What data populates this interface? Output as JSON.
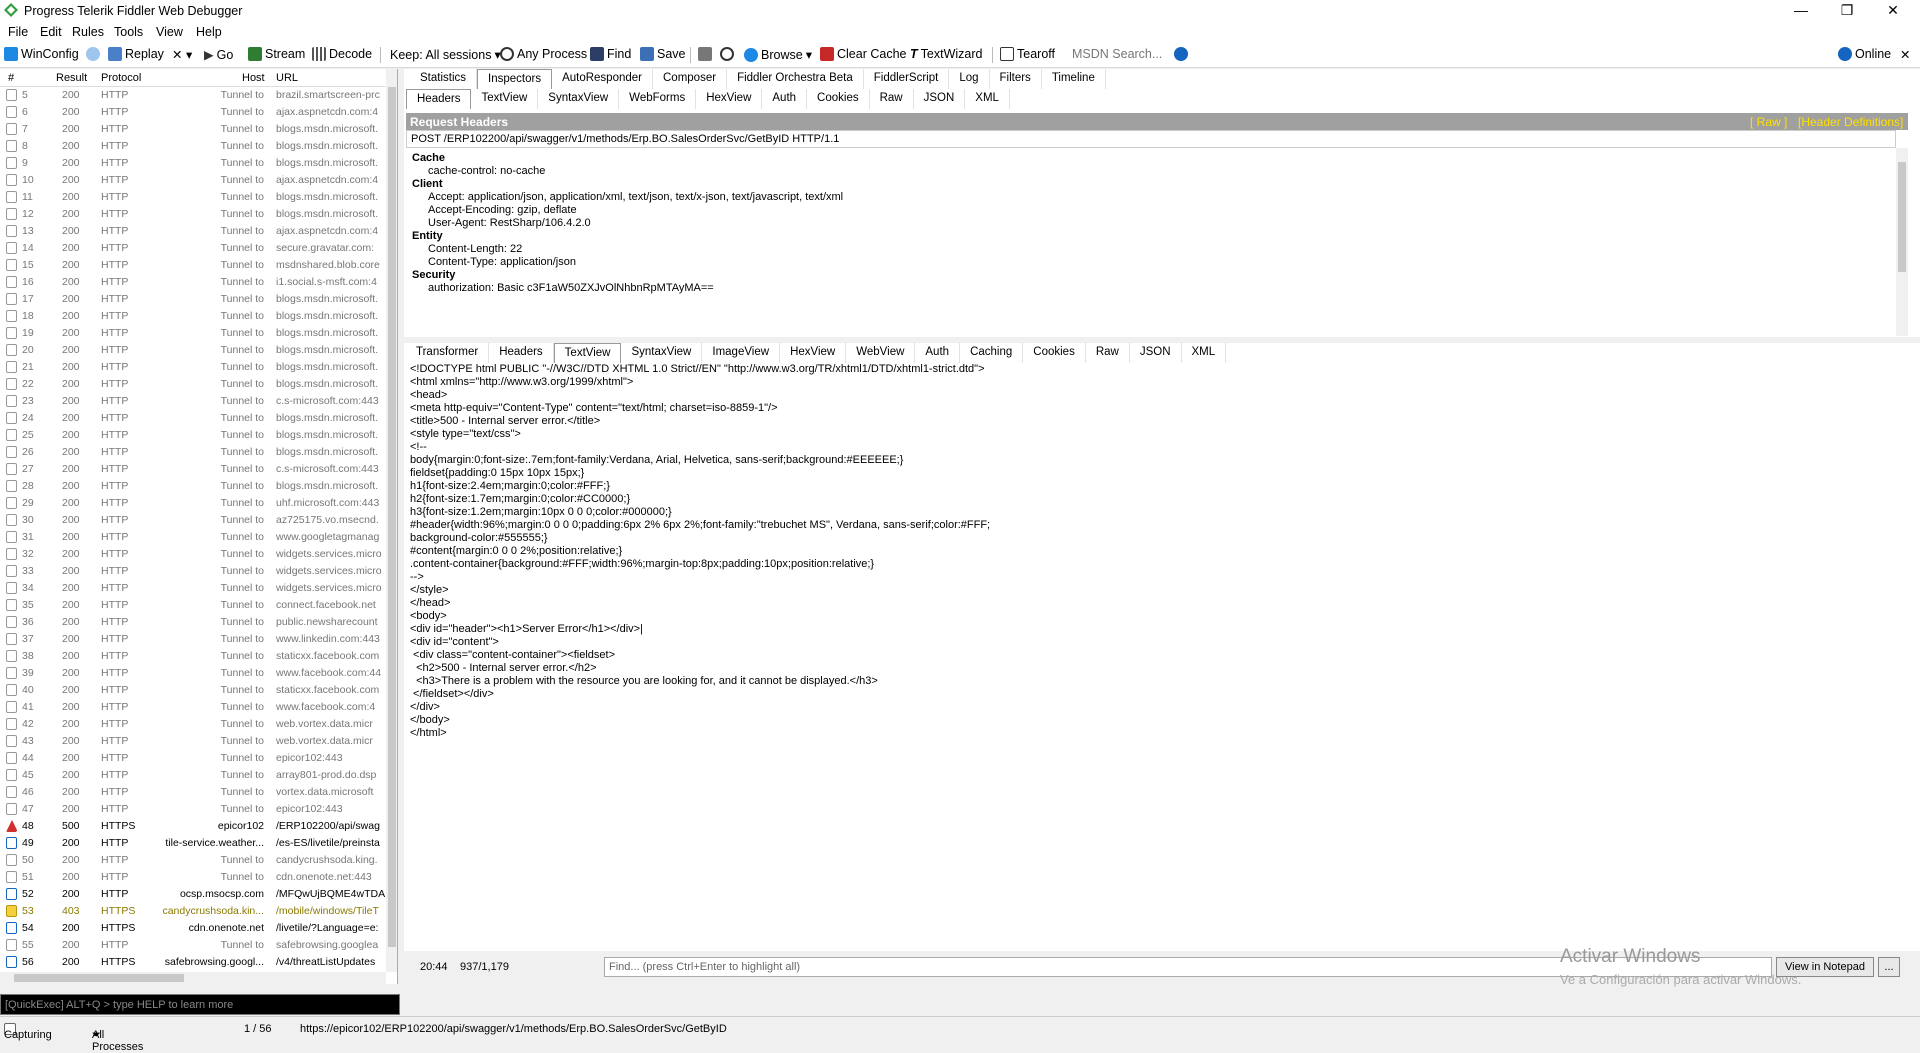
{
  "app": {
    "title": "Progress Telerik Fiddler Web Debugger"
  },
  "menu": [
    "File",
    "Edit",
    "Rules",
    "Tools",
    "View",
    "Help"
  ],
  "toolbar": {
    "winconfig": "WinConfig",
    "replay": "Replay",
    "x": "✕ ▾",
    "go": "Go",
    "stream": "Stream",
    "decode": "Decode",
    "keep": "Keep: All sessions",
    "any_process": "Any Process",
    "find": "Find",
    "save": "Save",
    "browse": "Browse",
    "clear_cache": "Clear Cache",
    "textwizard": "TextWizard",
    "tearoff": "Tearoff",
    "msdn_placeholder": "MSDN Search...",
    "online": "Online"
  },
  "sessions": {
    "headers": [
      "#",
      "Result",
      "Protocol",
      "Host",
      "URL"
    ],
    "rows": [
      [
        "5",
        "200",
        "HTTP",
        "Tunnel to",
        "brazil.smartscreen-prc"
      ],
      [
        "6",
        "200",
        "HTTP",
        "Tunnel to",
        "ajax.aspnetcdn.com:4"
      ],
      [
        "7",
        "200",
        "HTTP",
        "Tunnel to",
        "blogs.msdn.microsoft."
      ],
      [
        "8",
        "200",
        "HTTP",
        "Tunnel to",
        "blogs.msdn.microsoft."
      ],
      [
        "9",
        "200",
        "HTTP",
        "Tunnel to",
        "blogs.msdn.microsoft."
      ],
      [
        "10",
        "200",
        "HTTP",
        "Tunnel to",
        "ajax.aspnetcdn.com:4"
      ],
      [
        "11",
        "200",
        "HTTP",
        "Tunnel to",
        "blogs.msdn.microsoft."
      ],
      [
        "12",
        "200",
        "HTTP",
        "Tunnel to",
        "blogs.msdn.microsoft."
      ],
      [
        "13",
        "200",
        "HTTP",
        "Tunnel to",
        "ajax.aspnetcdn.com:4"
      ],
      [
        "14",
        "200",
        "HTTP",
        "Tunnel to",
        "secure.gravatar.com:"
      ],
      [
        "15",
        "200",
        "HTTP",
        "Tunnel to",
        "msdnshared.blob.core"
      ],
      [
        "16",
        "200",
        "HTTP",
        "Tunnel to",
        "i1.social.s-msft.com:4"
      ],
      [
        "17",
        "200",
        "HTTP",
        "Tunnel to",
        "blogs.msdn.microsoft."
      ],
      [
        "18",
        "200",
        "HTTP",
        "Tunnel to",
        "blogs.msdn.microsoft."
      ],
      [
        "19",
        "200",
        "HTTP",
        "Tunnel to",
        "blogs.msdn.microsoft."
      ],
      [
        "20",
        "200",
        "HTTP",
        "Tunnel to",
        "blogs.msdn.microsoft."
      ],
      [
        "21",
        "200",
        "HTTP",
        "Tunnel to",
        "blogs.msdn.microsoft."
      ],
      [
        "22",
        "200",
        "HTTP",
        "Tunnel to",
        "blogs.msdn.microsoft."
      ],
      [
        "23",
        "200",
        "HTTP",
        "Tunnel to",
        "c.s-microsoft.com:443"
      ],
      [
        "24",
        "200",
        "HTTP",
        "Tunnel to",
        "blogs.msdn.microsoft."
      ],
      [
        "25",
        "200",
        "HTTP",
        "Tunnel to",
        "blogs.msdn.microsoft."
      ],
      [
        "26",
        "200",
        "HTTP",
        "Tunnel to",
        "blogs.msdn.microsoft."
      ],
      [
        "27",
        "200",
        "HTTP",
        "Tunnel to",
        "c.s-microsoft.com:443"
      ],
      [
        "28",
        "200",
        "HTTP",
        "Tunnel to",
        "blogs.msdn.microsoft."
      ],
      [
        "29",
        "200",
        "HTTP",
        "Tunnel to",
        "uhf.microsoft.com:443"
      ],
      [
        "30",
        "200",
        "HTTP",
        "Tunnel to",
        "az725175.vo.msecnd."
      ],
      [
        "31",
        "200",
        "HTTP",
        "Tunnel to",
        "www.googletagmanag"
      ],
      [
        "32",
        "200",
        "HTTP",
        "Tunnel to",
        "widgets.services.micro"
      ],
      [
        "33",
        "200",
        "HTTP",
        "Tunnel to",
        "widgets.services.micro"
      ],
      [
        "34",
        "200",
        "HTTP",
        "Tunnel to",
        "widgets.services.micro"
      ],
      [
        "35",
        "200",
        "HTTP",
        "Tunnel to",
        "connect.facebook.net"
      ],
      [
        "36",
        "200",
        "HTTP",
        "Tunnel to",
        "public.newsharecount"
      ],
      [
        "37",
        "200",
        "HTTP",
        "Tunnel to",
        "www.linkedin.com:443"
      ],
      [
        "38",
        "200",
        "HTTP",
        "Tunnel to",
        "staticxx.facebook.com"
      ],
      [
        "39",
        "200",
        "HTTP",
        "Tunnel to",
        "www.facebook.com:44"
      ],
      [
        "40",
        "200",
        "HTTP",
        "Tunnel to",
        "staticxx.facebook.com"
      ],
      [
        "41",
        "200",
        "HTTP",
        "Tunnel to",
        "www.facebook.com:4"
      ],
      [
        "42",
        "200",
        "HTTP",
        "Tunnel to",
        "web.vortex.data.micr"
      ],
      [
        "43",
        "200",
        "HTTP",
        "Tunnel to",
        "web.vortex.data.micr"
      ],
      [
        "44",
        "200",
        "HTTP",
        "Tunnel to",
        "epicor102:443"
      ],
      [
        "45",
        "200",
        "HTTP",
        "Tunnel to",
        "array801-prod.do.dsp"
      ],
      [
        "46",
        "200",
        "HTTP",
        "Tunnel to",
        "vortex.data.microsoft"
      ],
      [
        "47",
        "200",
        "HTTP",
        "Tunnel to",
        "epicor102:443"
      ],
      [
        "48",
        "500",
        "HTTPS",
        "epicor102",
        "/ERP102200/api/swag"
      ],
      [
        "49",
        "200",
        "HTTP",
        "tile-service.weather...",
        "/es-ES/livetile/preinsta"
      ],
      [
        "50",
        "200",
        "HTTP",
        "Tunnel to",
        "candycrushsoda.king."
      ],
      [
        "51",
        "200",
        "HTTP",
        "Tunnel to",
        "cdn.onenote.net:443"
      ],
      [
        "52",
        "200",
        "HTTP",
        "ocsp.msocsp.com",
        "/MFQwUjBQME4wTDA"
      ],
      [
        "53",
        "403",
        "HTTPS",
        "candycrushsoda.kin...",
        "/mobile/windows/TileT"
      ],
      [
        "54",
        "200",
        "HTTPS",
        "cdn.onenote.net",
        "/livetile/?Language=e:"
      ],
      [
        "55",
        "200",
        "HTTP",
        "Tunnel to",
        "safebrowsing.googlea"
      ],
      [
        "56",
        "200",
        "HTTPS",
        "safebrowsing.googl...",
        "/v4/threatListUpdates"
      ]
    ]
  },
  "inspector_tabs": [
    "Statistics",
    "Inspectors",
    "AutoResponder",
    "Composer",
    "Fiddler Orchestra Beta",
    "FiddlerScript",
    "Log",
    "Filters",
    "Timeline"
  ],
  "request_tabs": [
    "Headers",
    "TextView",
    "SyntaxView",
    "WebForms",
    "HexView",
    "Auth",
    "Cookies",
    "Raw",
    "JSON",
    "XML"
  ],
  "request": {
    "title": "Request Headers",
    "raw_link": "[ Raw ]",
    "defs_link": "[Header Definitions]",
    "line": "POST /ERP102200/api/swagger/v1/methods/Erp.BO.SalesOrderSvc/GetByID HTTP/1.1",
    "sections": [
      {
        "name": "Cache",
        "items": [
          "cache-control: no-cache"
        ]
      },
      {
        "name": "Client",
        "items": [
          "Accept: application/json, application/xml, text/json, text/x-json, text/javascript, text/xml",
          "Accept-Encoding: gzip, deflate",
          "User-Agent: RestSharp/106.4.2.0"
        ]
      },
      {
        "name": "Entity",
        "items": [
          "Content-Length: 22",
          "Content-Type: application/json"
        ]
      },
      {
        "name": "Security",
        "items": [
          "authorization: Basic c3F1aW50ZXJvOlNhbnRpMTAyMA=="
        ]
      }
    ]
  },
  "response_tabs": [
    "Transformer",
    "Headers",
    "TextView",
    "SyntaxView",
    "ImageView",
    "HexView",
    "WebView",
    "Auth",
    "Caching",
    "Cookies",
    "Raw",
    "JSON",
    "XML"
  ],
  "response_body": "<!DOCTYPE html PUBLIC \"-//W3C//DTD XHTML 1.0 Strict//EN\" \"http://www.w3.org/TR/xhtml1/DTD/xhtml1-strict.dtd\">\n<html xmlns=\"http://www.w3.org/1999/xhtml\">\n<head>\n<meta http-equiv=\"Content-Type\" content=\"text/html; charset=iso-8859-1\"/>\n<title>500 - Internal server error.</title>\n<style type=\"text/css\">\n<!--\nbody{margin:0;font-size:.7em;font-family:Verdana, Arial, Helvetica, sans-serif;background:#EEEEEE;}\nfieldset{padding:0 15px 10px 15px;}\nh1{font-size:2.4em;margin:0;color:#FFF;}\nh2{font-size:1.7em;margin:0;color:#CC0000;}\nh3{font-size:1.2em;margin:10px 0 0 0;color:#000000;}\n#header{width:96%;margin:0 0 0 0;padding:6px 2% 6px 2%;font-family:\"trebuchet MS\", Verdana, sans-serif;color:#FFF;\nbackground-color:#555555;}\n#content{margin:0 0 0 2%;position:relative;}\n.content-container{background:#FFF;width:96%;margin-top:8px;padding:10px;position:relative;}\n-->\n</style>\n</head>\n<body>\n<div id=\"header\"><h1>Server Error</h1></div>|\n<div id=\"content\">\n <div class=\"content-container\"><fieldset>\n  <h2>500 - Internal server error.</h2>\n  <h3>There is a problem with the resource you are looking for, and it cannot be displayed.</h3>\n </fieldset></div>\n</div>\n</body>\n</html>",
  "bottom": {
    "pos": "20:44",
    "count": "937/1,179",
    "find_placeholder": "Find... (press Ctrl+Enter to highlight all)",
    "notepad": "View in Notepad",
    "more": "..."
  },
  "quickexec": "[QuickExec] ALT+Q > type HELP to learn more",
  "status": {
    "capturing": "Capturing",
    "processes": "All Processes",
    "count": "1 / 56",
    "url": "https://epicor102/ERP102200/api/swagger/v1/methods/Erp.BO.SalesOrderSvc/GetByID"
  },
  "watermark": {
    "line1": "Activar Windows",
    "line2": "Ve a Configuración para activar Windows."
  }
}
